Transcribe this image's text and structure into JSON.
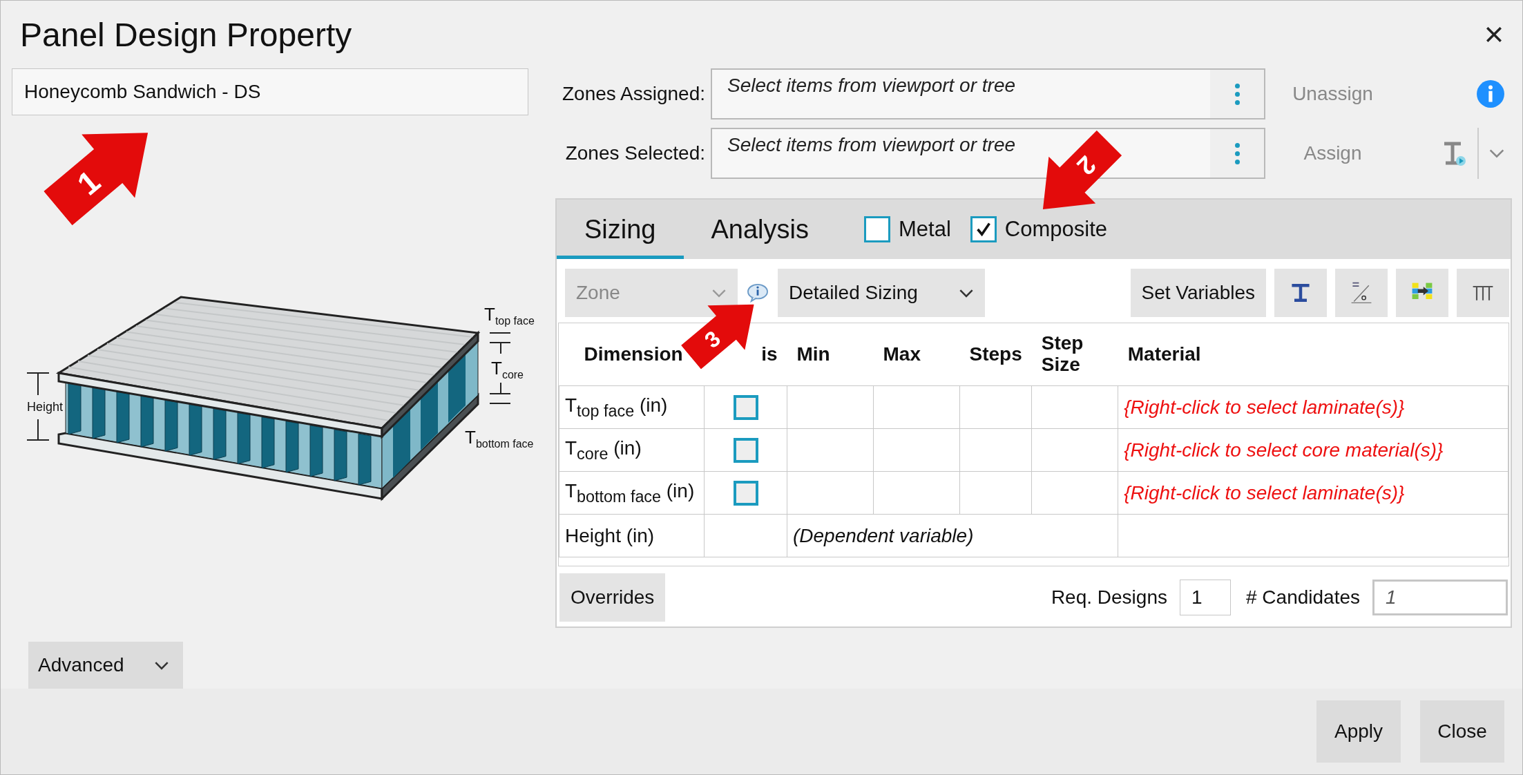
{
  "window": {
    "title": "Panel Design Property"
  },
  "name_field": {
    "value": "Honeycomb Sandwich - DS"
  },
  "diagram": {
    "height_label": "Height",
    "thickness_labels": [
      {
        "main": "T",
        "sub": "top face"
      },
      {
        "main": "T",
        "sub": "core"
      },
      {
        "main": "T",
        "sub": "bottom face"
      }
    ]
  },
  "advanced_button": "Advanced",
  "zones": [
    {
      "label": "Zones Assigned:",
      "placeholder": "Select items from viewport or tree",
      "action": "Unassign",
      "disabled": true
    },
    {
      "label": "Zones Selected:",
      "placeholder": "Select items from viewport or tree",
      "action": "Assign",
      "disabled": true
    }
  ],
  "tabs": [
    {
      "label": "Sizing",
      "selected": true
    },
    {
      "label": "Analysis",
      "selected": false
    }
  ],
  "checkboxes": [
    {
      "label": "Metal",
      "checked": false
    },
    {
      "label": "Composite",
      "checked": true
    }
  ],
  "zone_dropdown": {
    "value": "Zone",
    "disabled": true
  },
  "sizing_dropdown": {
    "value": "Detailed Sizing"
  },
  "set_variables_button": "Set Variables",
  "table": {
    "columns": [
      "Dimension",
      "is",
      "Min",
      "Max",
      "Steps",
      "Step Size",
      "Material"
    ],
    "rows": [
      {
        "kind": "variable",
        "dimension": "T$_{top face}$ (in)",
        "checked": false,
        "material": "{Right-click to select laminate(s)}"
      },
      {
        "kind": "variable",
        "dimension": "T$_{core}$ (in)",
        "checked": false,
        "material": "{Right-click to select core material(s)}"
      },
      {
        "kind": "variable",
        "dimension": "T$_{bottom face}$ (in)",
        "checked": false,
        "material": "{Right-click to select laminate(s)}"
      },
      {
        "kind": "dependent",
        "dimension": "Height (in)",
        "note": "(Dependent variable)"
      }
    ]
  },
  "overrides_button": "Overrides",
  "req_designs": {
    "label": "Req. Designs",
    "value": "1"
  },
  "candidates": {
    "label": "# Candidates",
    "value": "1"
  },
  "buttons": [
    "Apply",
    "Close"
  ],
  "callouts": [
    {
      "label": "1"
    },
    {
      "label": "2"
    },
    {
      "label": "3"
    }
  ]
}
